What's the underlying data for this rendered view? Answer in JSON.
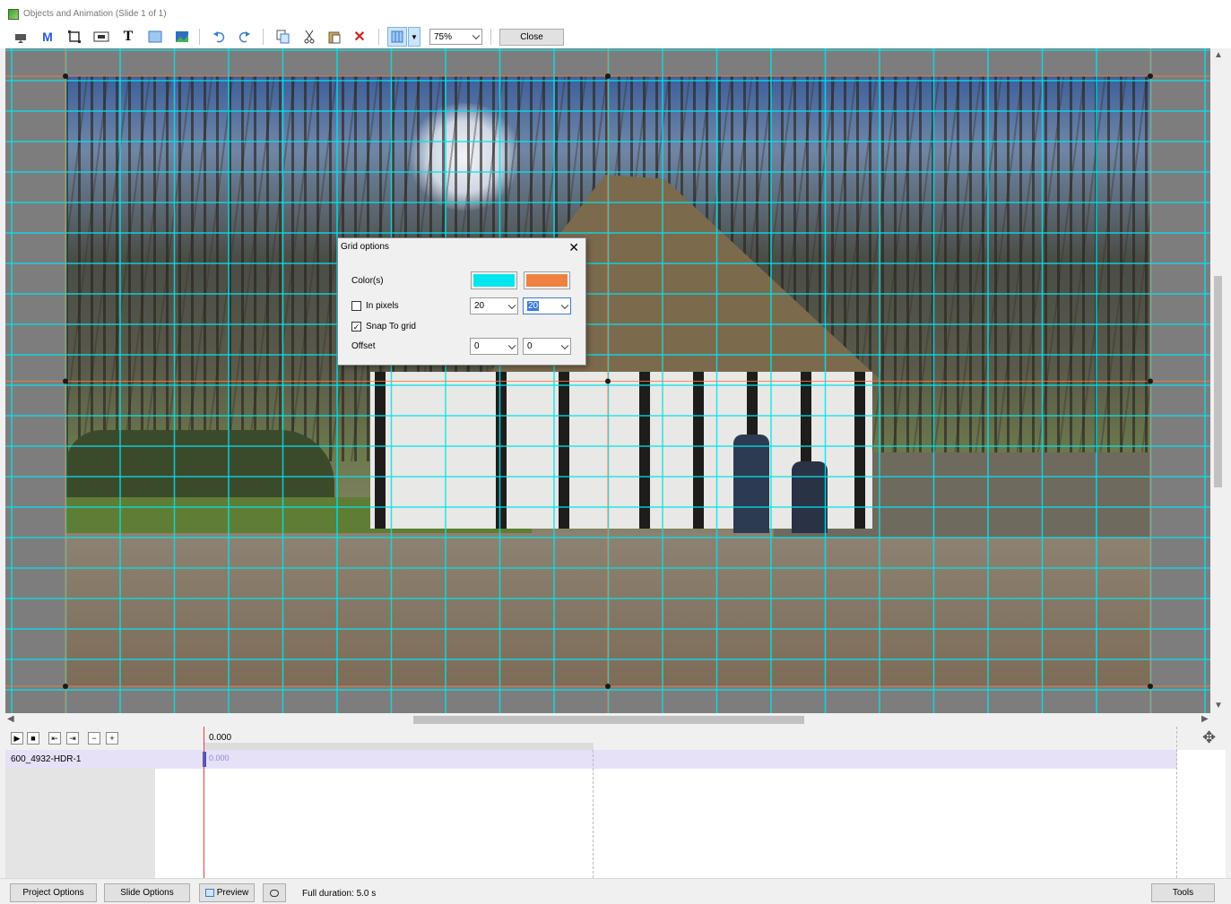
{
  "window": {
    "title": "Objects and Animation (Slide 1 of 1)"
  },
  "toolbar": {
    "icons": [
      "camera-icon",
      "mask-icon",
      "frame-icon",
      "button-icon",
      "text-icon",
      "rectangle-icon",
      "image-icon",
      "undo-icon",
      "redo-icon",
      "copy-icon",
      "cut-icon",
      "paste-icon",
      "delete-icon",
      "grid-icon"
    ],
    "zoom_value": "75%",
    "close_label": "Close"
  },
  "colors": {
    "grid_primary": "#00e5ee",
    "grid_secondary": "#f08040",
    "accent": "#3a7bd5"
  },
  "grid_options": {
    "title": "Grid options",
    "colors_label": "Color(s)",
    "in_pixels_label": "In pixels",
    "in_pixels_checked": false,
    "grid_x": "20",
    "grid_y": "20",
    "snap_label": "Snap To grid",
    "snap_checked": true,
    "offset_label": "Offset",
    "offset_x": "0",
    "offset_y": "0"
  },
  "timeline": {
    "start_time": "0.000",
    "track_name": "600_4932-HDR-1",
    "track_time": "0.000",
    "controls": [
      "play-icon",
      "stop-icon",
      "prev-icon",
      "next-icon",
      "minus-icon",
      "plus-icon"
    ]
  },
  "status": {
    "project_options": "Project Options",
    "slide_options": "Slide Options",
    "preview": "Preview",
    "full_duration": "Full duration: 5.0 s",
    "tools": "Tools"
  }
}
